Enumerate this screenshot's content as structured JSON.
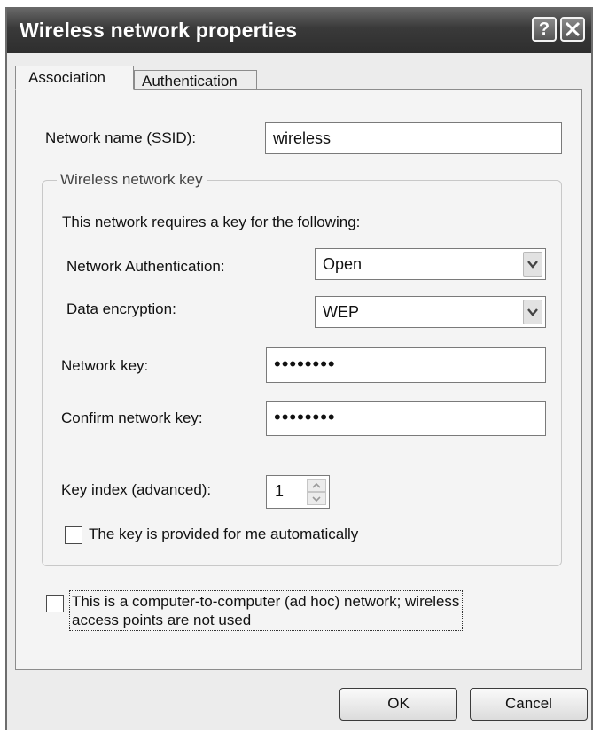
{
  "window": {
    "title": "Wireless network properties"
  },
  "title_buttons": {
    "help": "?",
    "close": "✕"
  },
  "tabs": [
    {
      "label": "Association"
    },
    {
      "label": "Authentication"
    }
  ],
  "association": {
    "ssid_label": "Network name (SSID):",
    "ssid_value": "wireless",
    "group_title": "Wireless network key",
    "requires_text": "This network requires a key for the following:",
    "auth_label": "Network Authentication:",
    "auth_value": "Open",
    "encryption_label": "Data encryption:",
    "encryption_value": "WEP",
    "key_label": "Network key:",
    "key_value": "••••••••",
    "confirm_label": "Confirm network key:",
    "confirm_value": "••••••••",
    "index_label": "Key index (advanced):",
    "index_value": "1",
    "auto_key_label": "The key is provided for me automatically",
    "auto_key_checked": false,
    "adhoc_label_line1": "This is a computer-to-computer (ad hoc) network; wireless",
    "adhoc_label_line2": "access points are not used",
    "adhoc_checked": false
  },
  "buttons": {
    "ok": "OK",
    "cancel": "Cancel"
  }
}
